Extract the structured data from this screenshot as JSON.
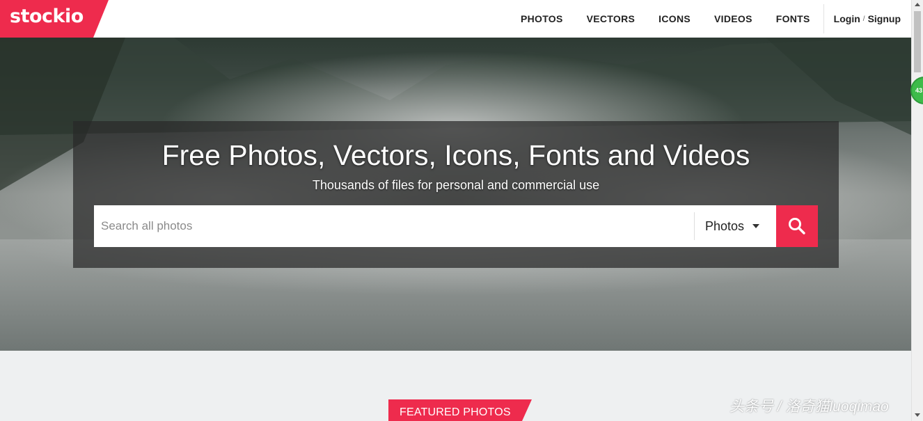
{
  "logo": {
    "text": "stockio"
  },
  "nav": {
    "items": [
      {
        "label": "PHOTOS"
      },
      {
        "label": "VECTORS"
      },
      {
        "label": "ICONS"
      },
      {
        "label": "VIDEOS"
      },
      {
        "label": "FONTS"
      }
    ],
    "login": "Login",
    "separator": "/",
    "signup": "Signup"
  },
  "hero": {
    "title": "Free Photos, Vectors, Icons, Fonts and Videos",
    "subtitle": "Thousands of files for personal and commercial use"
  },
  "search": {
    "placeholder": "Search all photos",
    "value": "",
    "type_selected": "Photos",
    "button_icon": "search-icon"
  },
  "featured": {
    "label": "FEATURED PHOTOS"
  },
  "watermark": "头条号 / 洛奇猫luoqimao",
  "badge": {
    "text": "43"
  },
  "colors": {
    "brand": "#ee2b4d",
    "header_bg": "#ffffff",
    "page_bg": "#eef0f1"
  }
}
